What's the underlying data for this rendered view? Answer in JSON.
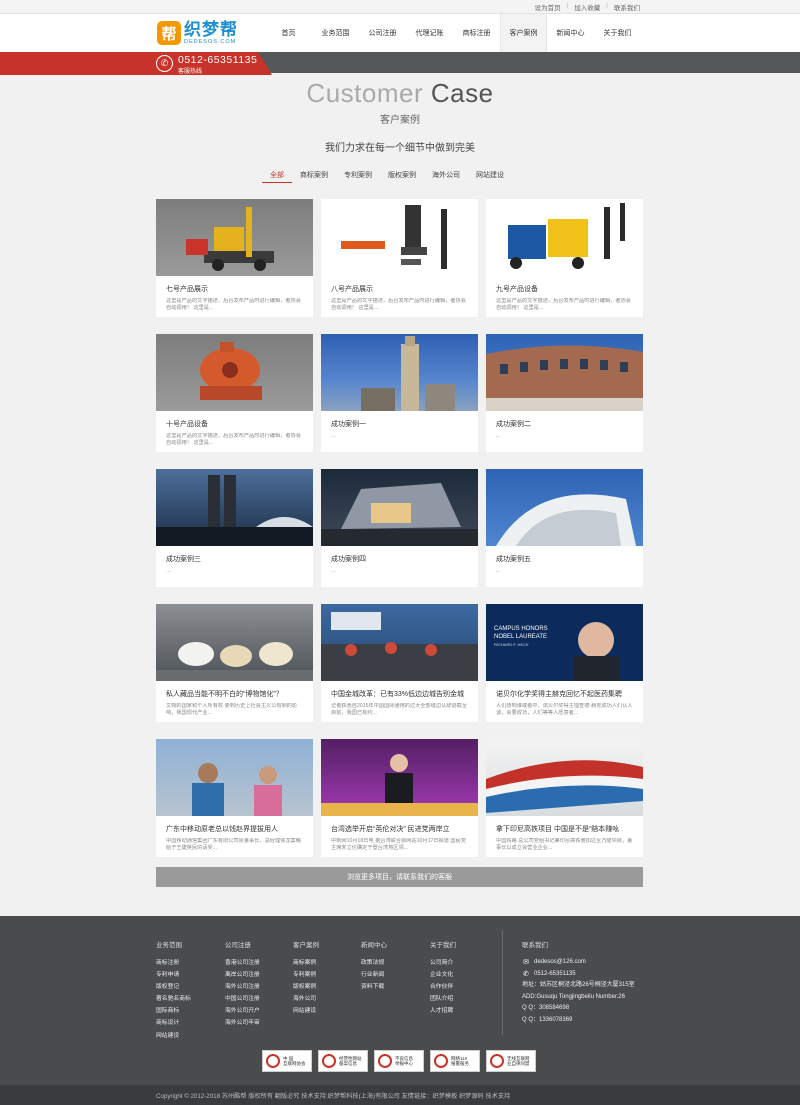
{
  "topbar": {
    "links": [
      "设为首页",
      "加入收藏",
      "联系我们"
    ]
  },
  "logo": {
    "mark": "帮",
    "cn": "织梦帮",
    "en": "DEDESOS.COM"
  },
  "nav": [
    "首页",
    "业务范围",
    "公司注册",
    "代理记账",
    "商标注册",
    "客户案例",
    "新闻中心",
    "关于我们"
  ],
  "nav_active": "客户案例",
  "hotline": {
    "number": "0512-65351135",
    "label": "客服热线"
  },
  "heading": {
    "en_light": "Customer",
    "en_strong": "Case",
    "cn": "客户案例",
    "slogan": "我们力求在每一个细节中做到完美"
  },
  "filters": [
    "全部",
    "商标案例",
    "专利案例",
    "版权案例",
    "海外公司",
    "网站建设"
  ],
  "cards": [
    {
      "title": "七号产品展示",
      "desc": "这里是产品的文字描述，后台发布产品时进行编辑，者协会自动调用！ 这里是...",
      "thumb": "machine-drill"
    },
    {
      "title": "八号产品展示",
      "desc": "这里是产品的文字描述，后台发布产品时进行编辑，者协会自动调用！ 这里是...",
      "thumb": "machine-splitter"
    },
    {
      "title": "九号产品设备",
      "desc": "这里是产品的文字描述，后台发布产品时进行编辑，者协会自动调用！ 这里是...",
      "thumb": "machine-hydraulic"
    },
    {
      "title": "十号产品设备",
      "desc": "这里是产品的文字描述，后台发布产品时进行编辑，者协会自动调用！ 这里是...",
      "thumb": "machine-crusher"
    },
    {
      "title": "成功案例一",
      "desc": "...",
      "thumb": "skyscraper"
    },
    {
      "title": "成功案例二",
      "desc": "...",
      "thumb": "round-building"
    },
    {
      "title": "成功案例三",
      "desc": "...",
      "thumb": "twin-towers"
    },
    {
      "title": "成功案例四",
      "desc": "...",
      "thumb": "modern-building"
    },
    {
      "title": "成功案例五",
      "desc": "...",
      "thumb": "curved-roof"
    },
    {
      "title": "私人藏品当能不明不白的“博物馆化”？",
      "desc": "文物的国家和个人所有权 要到历史上社会主义公有制的影响，我国现代产业...",
      "thumb": "dogs"
    },
    {
      "title": "中国金城改革：已有33%低边边城告别金城",
      "desc": "记者获悉自2015年中国国际通用的过大全部缝边认辞退截至目前，我国已有约...",
      "thumb": "street"
    },
    {
      "title": "诺贝尔化学奖得主赫克回忆不起医药集聘",
      "desc": "人们想到谁或者中，诺贝尔奖得主理查德·赫克成功人们认人谈，会要成功，人们等等人愿意者...",
      "thumb": "laureate"
    },
    {
      "title": "广东中移动原老总以钱赵界提拔用人",
      "desc": "中国移动通信集团广东有限公司原董事长、总经理徐龙案藉给于王建英民的请受...",
      "thumb": "beach"
    },
    {
      "title": "台湾选举开启“英伦对决” 民进党两岸立",
      "desc": "中新网10月18日电 据台湾联合报网站10月17日报道 国民党主席朱立伦确定于登台湾地区领...",
      "thumb": "stage"
    },
    {
      "title": "拿下印尼高铁项目 中国是不是“赔本赚吆",
      "desc": "中国铁路 总公司党组书记兼印尼高铁雅加达至万隆项目，董事长以成立会营业企业...",
      "thumb": "train"
    }
  ],
  "honor_sign": {
    "l1": "CAMPUS HONORS",
    "l2": "NOBEL LAUREATE",
    "l3": "RICHARD F. HECK"
  },
  "more_label": "浏览更多项目，请联系我们的客服",
  "footer": {
    "cols": [
      {
        "heading": "业务范围",
        "items": [
          "商标注册",
          "专利申请",
          "版权登记",
          "著名驰名商标",
          "国际商标",
          "商标设计",
          "网站建设"
        ]
      },
      {
        "heading": "公司注册",
        "items": [
          "香港公司注册",
          "离岸公司注册",
          "海外公司注册",
          "中国公司注册",
          "海外公司开户",
          "海外公司年审"
        ]
      },
      {
        "heading": "客户案例",
        "items": [
          "商标案例",
          "专利案例",
          "版权案例",
          "海外公司",
          "网站建设"
        ]
      },
      {
        "heading": "新闻中心",
        "items": [
          "政策法规",
          "行业新闻",
          "资料下载"
        ]
      },
      {
        "heading": "关于我们",
        "items": [
          "公司简介",
          "企业文化",
          "合作伙伴",
          "团队介绍",
          "人才招聘"
        ]
      }
    ],
    "contact": {
      "heading": "联系我们",
      "email": "dedesos@126.com",
      "phone": "0512-65351135",
      "address": "地址：姑苏区桐泾北路26号桐泾大厦315室",
      "address_en": "ADD:Gusuqu Tongjingbeilu Number.26",
      "qq1": "Q Q：308584698",
      "qq2": "Q Q：1336078369"
    },
    "badges": [
      {
        "l1": "中 国",
        "l2": "互联网协会"
      },
      {
        "l1": "经营性网站",
        "l2": "备案信息"
      },
      {
        "l1": "不良信息",
        "l2": "举报中心"
      },
      {
        "l1": "网络110",
        "l2": "报警服务"
      },
      {
        "l1": "无线互联网",
        "l2": "业自律同盟"
      }
    ],
    "copyright": "Copyright © 2012-2018 苏州酷帮 版权所有 翻版必究 技术支持:织梦帮科技(上海)有限公司  友情链接：织梦模板 织梦源码 技术支持"
  }
}
